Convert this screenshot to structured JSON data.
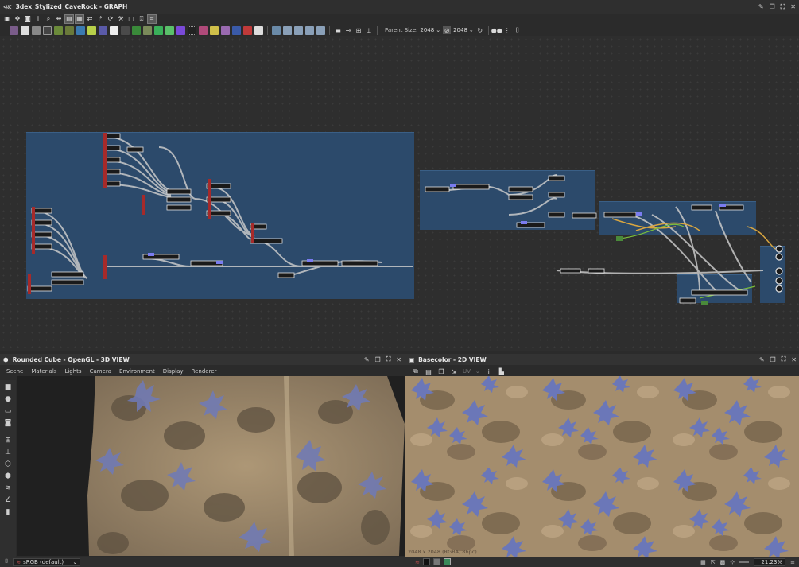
{
  "graph_panel": {
    "title": "3dex_Stylized_CaveRock - GRAPH",
    "parent_size_label": "Parent Size:",
    "parent_size_value": "2048",
    "output_size_value": "2048"
  },
  "view3d": {
    "title": "Rounded Cube - OpenGL - 3D VIEW",
    "menu": [
      "Scene",
      "Materials",
      "Lights",
      "Camera",
      "Environment",
      "Display",
      "Renderer"
    ],
    "colorspace": "sRGB (default)"
  },
  "view2d": {
    "title": "Basecolor - 2D VIEW",
    "uv_label": "UV",
    "image_info": "2048 x 2048 (RGBA, 8bpc)",
    "zoom": "21.23%"
  },
  "colors": {
    "frame_blue": "#2c4a6b",
    "rock_tan": "#a08a6e",
    "moss_blue": "#6f7ab8"
  }
}
